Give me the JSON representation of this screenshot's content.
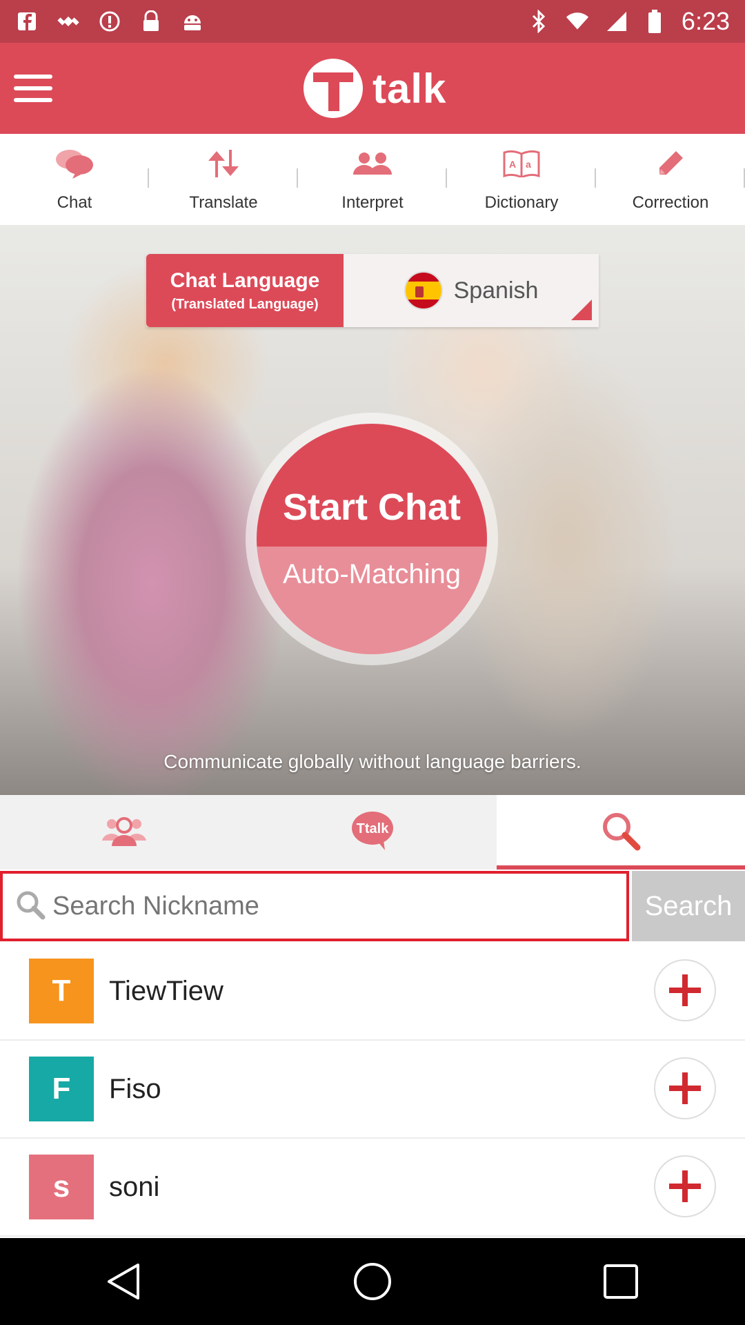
{
  "status_bar": {
    "time": "6:23",
    "left_icons": [
      "facebook-icon",
      "satellite-icon",
      "alert-icon",
      "lock-icon",
      "android-icon"
    ],
    "right_icons": [
      "bluetooth-icon",
      "wifi-icon",
      "signal-icon",
      "battery-icon"
    ]
  },
  "app_bar": {
    "logo_text": "talk",
    "menu_icon": "hamburger-menu-icon"
  },
  "features": [
    {
      "label": "Chat",
      "icon": "chat-bubbles-icon"
    },
    {
      "label": "Translate",
      "icon": "swap-arrows-icon"
    },
    {
      "label": "Interpret",
      "icon": "people-icon"
    },
    {
      "label": "Dictionary",
      "icon": "dictionary-book-icon"
    },
    {
      "label": "Correction",
      "icon": "pencil-icon"
    }
  ],
  "language_selector": {
    "title": "Chat Language",
    "subtitle": "(Translated Language)",
    "selected": "Spanish",
    "flag_icon": "spain-flag-icon"
  },
  "start_chat": {
    "title": "Start Chat",
    "subtitle": "Auto-Matching"
  },
  "tagline": "Communicate globally without language barriers.",
  "tabs": [
    {
      "icon": "friends-icon",
      "active": false
    },
    {
      "icon": "ttalk-bubble-icon",
      "active": false
    },
    {
      "icon": "search-icon",
      "active": true
    }
  ],
  "search": {
    "placeholder": "Search Nickname",
    "button_label": "Search"
  },
  "users": [
    {
      "initial": "T",
      "nickname": "TiewTiew",
      "color": "#f7941d"
    },
    {
      "initial": "F",
      "nickname": "Fiso",
      "color": "#17a9a5"
    },
    {
      "initial": "s",
      "nickname": "soni",
      "color": "#e5707d"
    }
  ],
  "colors": {
    "brand": "#dc4a58",
    "status_bar": "#bb3e4b",
    "search_border": "#e0202d"
  }
}
